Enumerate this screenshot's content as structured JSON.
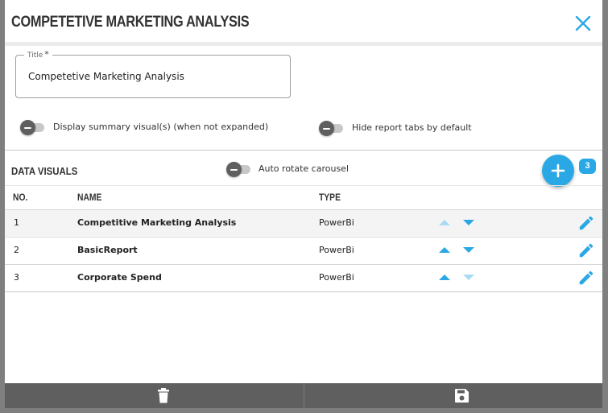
{
  "dialog": {
    "title": "COMPETETIVE MARKETING ANALYSIS",
    "close_icon": "close-icon"
  },
  "title_field": {
    "label": "Title",
    "required_marker": "*",
    "value": "Competetive Marketing Analysis"
  },
  "options": {
    "display_summary": {
      "label": "Display summary visual(s) (when not expanded)",
      "enabled": false
    },
    "hide_report_tabs": {
      "label": "Hide report tabs by default",
      "enabled": false
    }
  },
  "data_visuals": {
    "title": "DATA VISUALS",
    "auto_rotate": {
      "label": "Auto rotate carousel",
      "enabled": false
    },
    "add_icon": "plus-icon",
    "count": "3",
    "columns": {
      "no": "NO.",
      "name": "NAME",
      "type": "TYPE"
    },
    "rows": [
      {
        "no": "1",
        "name": "Competitive Marketing Analysis",
        "type": "PowerBi",
        "up_enabled": false,
        "down_enabled": true
      },
      {
        "no": "2",
        "name": "BasicReport",
        "type": "PowerBi",
        "up_enabled": true,
        "down_enabled": true
      },
      {
        "no": "3",
        "name": "Corporate Spend",
        "type": "PowerBi",
        "up_enabled": true,
        "down_enabled": false
      }
    ]
  },
  "footer": {
    "delete_icon": "trash-icon",
    "save_icon": "save-icon"
  },
  "colors": {
    "accent": "#2aa8e6",
    "accent_disabled": "#a9dcf4",
    "footer": "#5f5f5f",
    "backdrop": "#7f7f7f"
  }
}
